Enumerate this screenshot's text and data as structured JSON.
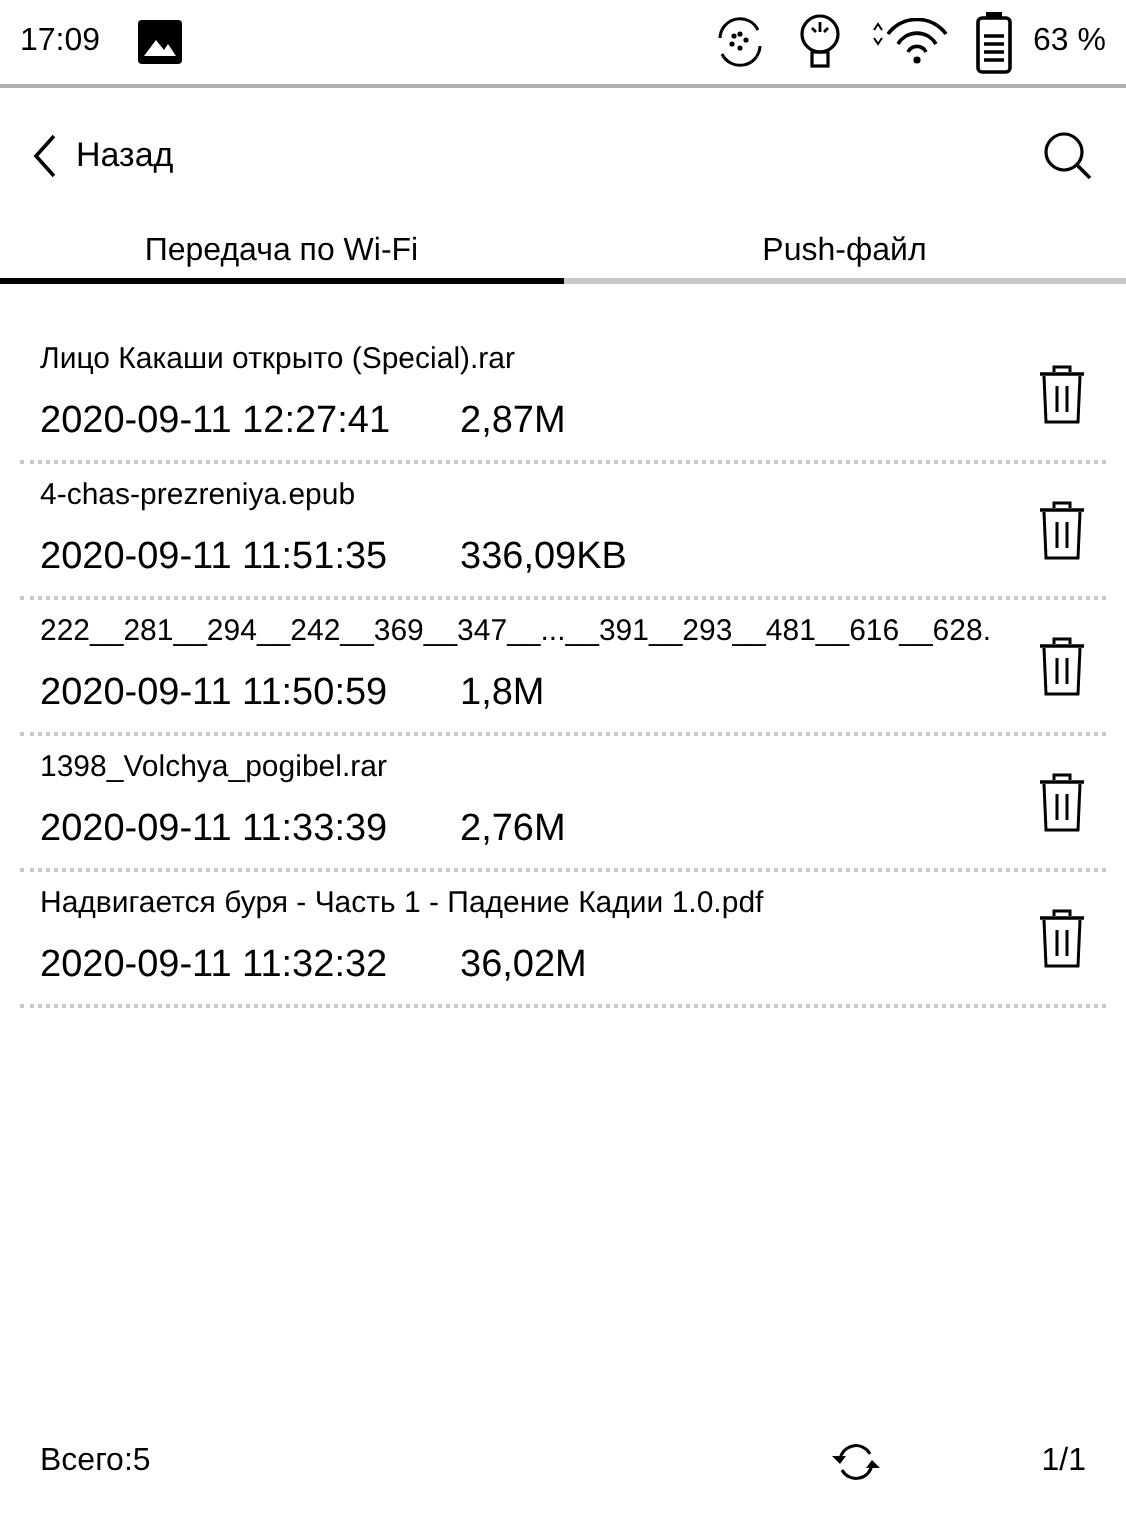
{
  "status_bar": {
    "time": "17:09",
    "battery": "63 %"
  },
  "header": {
    "back_label": "Назад"
  },
  "tabs": [
    {
      "label": "Передача по Wi-Fi",
      "selected": true
    },
    {
      "label": "Push-файл",
      "selected": false
    }
  ],
  "files": [
    {
      "name": "Лицо Какаши открыто (Special).rar",
      "date": "2020-09-11 12:27:41",
      "size": "2,87M"
    },
    {
      "name": "4-chas-prezreniya.epub",
      "date": "2020-09-11 11:51:35",
      "size": "336,09KB"
    },
    {
      "name": "222__281__294__242__369__347__...__391__293__481__616__628.",
      "date": "2020-09-11 11:50:59",
      "size": "1,8M"
    },
    {
      "name": "1398_Volchya_pogibel.rar",
      "date": "2020-09-11 11:33:39",
      "size": "2,76M"
    },
    {
      "name": "Надвигается буря - Часть 1 - Падение Кадии 1.0.pdf",
      "date": "2020-09-11 11:32:32",
      "size": "36,02M"
    }
  ],
  "footer": {
    "total": "Всего:5",
    "page": "1/1"
  }
}
